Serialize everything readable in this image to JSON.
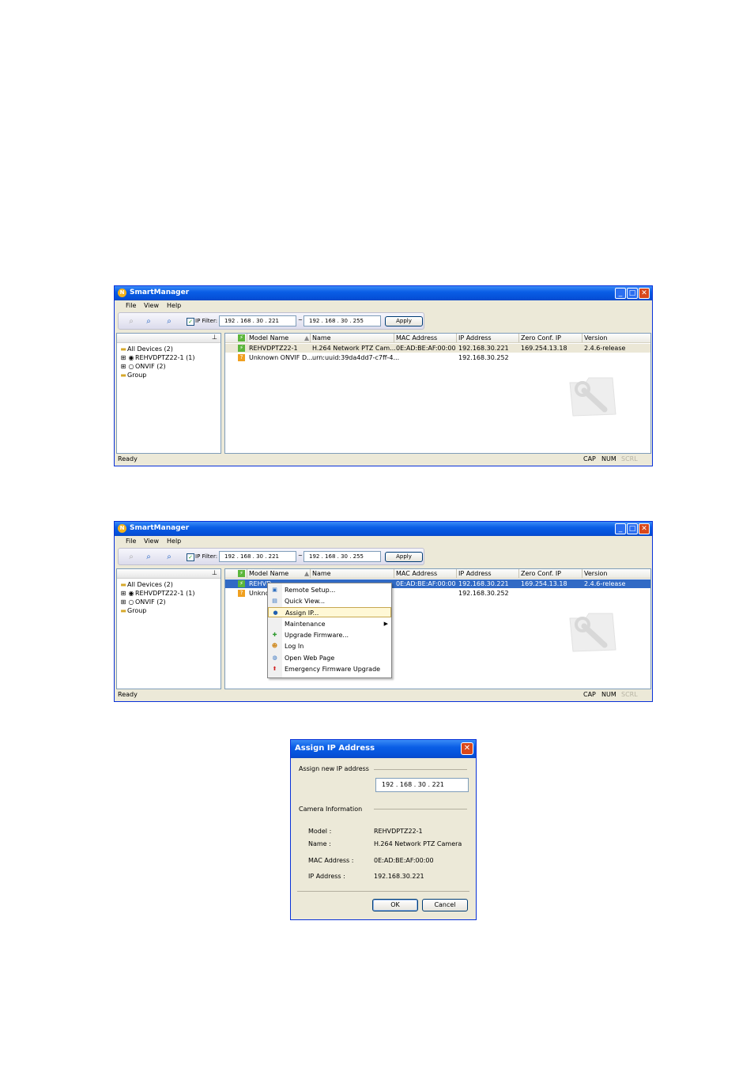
{
  "window1": {
    "title": "SmartManager",
    "menu": [
      "File",
      "View",
      "Help"
    ],
    "ip_filter": {
      "label": "IP Filter:",
      "from": "192  .  168  .  30  .  221",
      "separator": "~",
      "to": "192  .  168  .  30  .  255",
      "apply": "Apply"
    },
    "tree": [
      {
        "icon": "folder-icon",
        "label": "All Devices (2)"
      },
      {
        "icon": "camera-icon",
        "label": "REHVDPTZ22-1 (1)"
      },
      {
        "icon": "onvif-icon",
        "label": "ONVIF (2)"
      },
      {
        "icon": "folder-icon",
        "label": "Group"
      }
    ],
    "columns": [
      "Model Name",
      "Name",
      "MAC Address",
      "IP Address",
      "Zero Conf. IP",
      "Version"
    ],
    "rows": [
      {
        "model": "REHVDPTZ22-1",
        "name": "H.264 Network PTZ Cam...",
        "mac": "0E:AD:BE:AF:00:00",
        "ip": "192.168.30.221",
        "zeroconf": "169.254.13.18",
        "version": "2.4.6-release"
      },
      {
        "model": "Unknown ONVIF D...",
        "name": "urn:uuid:39da4dd7-c7ff-4...",
        "mac": "",
        "ip": "192.168.30.252",
        "zeroconf": "",
        "version": ""
      }
    ],
    "status": {
      "left": "Ready",
      "cap": "CAP",
      "num": "NUM",
      "scrl": "SCRL"
    }
  },
  "window2": {
    "title": "SmartManager",
    "menu": [
      "File",
      "View",
      "Help"
    ],
    "ip_filter": {
      "label": "IP Filter:",
      "from": "192  .  168  .  30  .  221",
      "separator": "~",
      "to": "192  .  168  .  30  .  255",
      "apply": "Apply"
    },
    "tree": [
      {
        "icon": "folder-icon",
        "label": "All Devices (2)"
      },
      {
        "icon": "camera-icon",
        "label": "REHVDPTZ22-1 (1)"
      },
      {
        "icon": "onvif-icon",
        "label": "ONVIF (2)"
      },
      {
        "icon": "folder-icon",
        "label": "Group"
      }
    ],
    "columns": [
      "Model Name",
      "Name",
      "MAC Address",
      "IP Address",
      "Zero Conf. IP",
      "Version"
    ],
    "rows": [
      {
        "model": "REHVD",
        "name": "",
        "mac": "0E:AD:BE:AF:00:00",
        "ip": "192.168.30.221",
        "zeroconf": "169.254.13.18",
        "version": "2.4.6-release"
      },
      {
        "model": "Unkno",
        "name": "",
        "mac": "",
        "ip": "192.168.30.252",
        "zeroconf": "",
        "version": ""
      }
    ],
    "context_menu": [
      {
        "icon": "remote-setup-icon",
        "label": "Remote Setup..."
      },
      {
        "icon": "quick-view-icon",
        "label": "Quick View..."
      },
      {
        "icon": "assign-ip-icon",
        "label": "Assign IP...",
        "selected": true
      },
      {
        "icon": "",
        "label": "Maintenance",
        "submenu": true
      },
      {
        "icon": "upgrade-firmware-icon",
        "label": "Upgrade Firmware..."
      },
      {
        "icon": "log-in-icon",
        "label": "Log In"
      },
      {
        "icon": "open-web-page-icon",
        "label": "Open Web Page"
      },
      {
        "icon": "emergency-upgrade-icon",
        "label": "Emergency Firmware Upgrade"
      }
    ],
    "status": {
      "left": "Ready",
      "cap": "CAP",
      "num": "NUM",
      "scrl": "SCRL"
    }
  },
  "dialog": {
    "title": "Assign IP Address",
    "new_ip_label": "Assign new IP address",
    "new_ip_value": "192  .  168  .  30  .  221",
    "camera_info_label": "Camera Information",
    "fields": [
      {
        "label": "Model :",
        "value": "REHVDPTZ22-1"
      },
      {
        "label": "Name :",
        "value": "H.264 Network PTZ Camera"
      },
      {
        "label": "MAC Address :",
        "value": "0E:AD:BE:AF:00:00"
      },
      {
        "label": "IP Address :",
        "value": "192.168.30.221"
      }
    ],
    "ok": "OK",
    "cancel": "Cancel"
  }
}
